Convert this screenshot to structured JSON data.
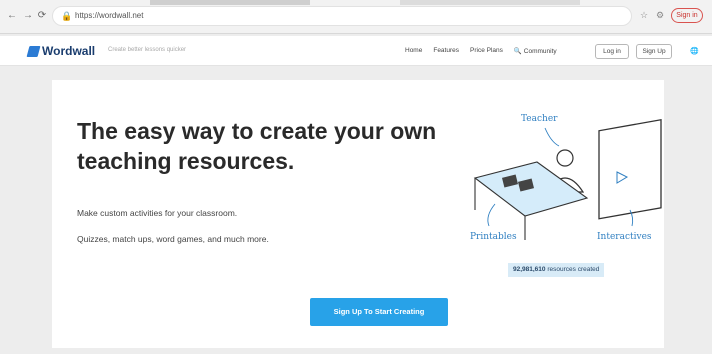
{
  "browser": {
    "url": "https://wordwall.net",
    "signin_label": "Sign in",
    "icons": {
      "back": "back-arrow-icon",
      "reload": "reload-icon",
      "lock": "lock-icon"
    }
  },
  "header": {
    "logo": "Wordwall",
    "tagline": "Create better lessons quicker",
    "nav": [
      "Home",
      "Features",
      "Price Plans",
      "Community"
    ],
    "login": "Log in",
    "signup": "Sign Up"
  },
  "hero": {
    "headline": "The easy way to create your own teaching resources.",
    "line1": "Make custom activities for your classroom.",
    "line2": "Quizzes, match ups, word games, and much more.",
    "cta": "Sign Up To Start Creating"
  },
  "illustration": {
    "teacher": "Teacher",
    "printables": "Printables",
    "interactives": "Interactives",
    "count": "92,981,610",
    "count_suffix": "resources created"
  },
  "colors": {
    "accent": "#28a2e8",
    "logo": "#1a3d6e",
    "illus": "#2f7fc1"
  }
}
